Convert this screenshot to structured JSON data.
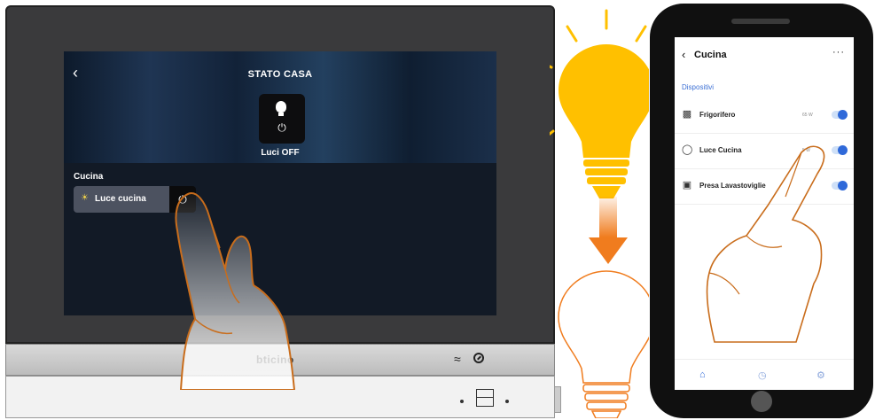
{
  "intercom": {
    "title": "STATO CASA",
    "tile_label": "Luci OFF",
    "power_glyph": "⏻",
    "room": "Cucina",
    "device_label": "Luce cucina",
    "brand": "bticino",
    "icons": [
      "back-icon",
      "bulb-icon",
      "power-icon",
      "wifi-icon",
      "do-not-disturb-icon",
      "home-key-icon"
    ]
  },
  "app": {
    "title": "Cucina",
    "menu": "···",
    "section": "Dispositivi",
    "devices": [
      {
        "name": "Frigorifero",
        "power": "65 W",
        "icon": "fridge-icon"
      },
      {
        "name": "Luce Cucina",
        "power": "5 W",
        "icon": "bulb-icon"
      },
      {
        "name": "Presa Lavastoviglie",
        "power": "",
        "icon": "socket-icon"
      }
    ],
    "tabs": [
      "home-tab",
      "history-tab",
      "settings-tab"
    ]
  },
  "colors": {
    "bulb_on": "#ffc000",
    "arrow": "#f07c1e",
    "hand_stroke": "#c96d1c",
    "app_accent": "#2f69d9"
  }
}
